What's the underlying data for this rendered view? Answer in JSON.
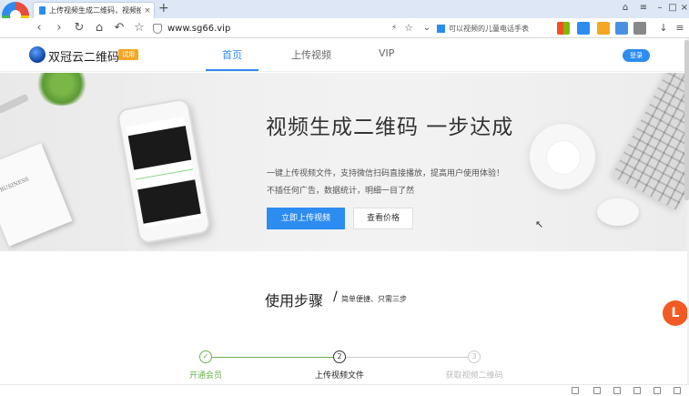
{
  "browser": {
    "tab_title": "上传视频生成二维码，视频拍...",
    "tab_close": "×",
    "new_tab": "+",
    "url": "www.sg66.vip",
    "search_text": "可以视频的儿童电话手表",
    "nav_icons": [
      "back-icon",
      "forward-icon",
      "reload-icon",
      "home-icon",
      "undo-icon",
      "star-icon"
    ],
    "glyphs": {
      "back": "‹",
      "forward": "›",
      "reload": "↻",
      "home": "⌂",
      "undo": "↶",
      "star": "☆",
      "bolt": "⚡",
      "fav": "☆",
      "dropdown": "⌄",
      "download": "↓",
      "menu": "≡",
      "minimize": "–",
      "maximize": "□",
      "close": "×",
      "skin": "⌂"
    }
  },
  "site": {
    "name": "双冠云二维码",
    "badge": "试用",
    "nav": {
      "home": "首页",
      "upload": "上传视频",
      "vip": "VIP"
    },
    "login": "登录"
  },
  "hero": {
    "title": "视频生成二维码 一步达成",
    "desc1": "一键上传视频文件，支持微信扫码直接播放，提高用户使用体验！",
    "desc2": "不插任何广告，数据统计，明细一目了然",
    "upload_button": "立即上传视频",
    "price_button": "查看价格",
    "notebook_text": "BUSINESS"
  },
  "steps": {
    "title": "使用步骤",
    "slash": "/",
    "subtitle": "简单便捷、只需三步",
    "items": [
      {
        "num": "✓",
        "label": "开通会员",
        "state": "done"
      },
      {
        "num": "2",
        "label": "上传视频文件",
        "state": "current"
      },
      {
        "num": "3",
        "label": "获取视频二维码",
        "state": "pending"
      }
    ]
  },
  "floater": "L",
  "colors": {
    "accent": "#2d8cf0",
    "done": "#6ab04c",
    "badge": "#f5a623",
    "pending": "#cccccc"
  }
}
